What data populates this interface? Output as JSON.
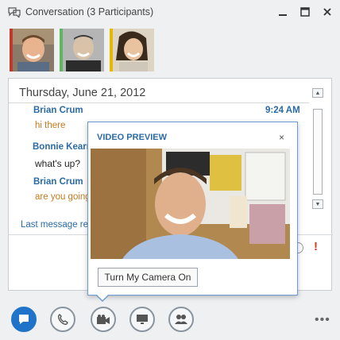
{
  "window": {
    "title": "Conversation (3 Participants)",
    "title_icon": "chat-bubbles-icon",
    "controls": [
      "minimize-icon",
      "maximize-icon",
      "close-icon"
    ]
  },
  "participants": [
    {
      "avatar": "participant-photo-1",
      "stripe_color": "#c0392b"
    },
    {
      "avatar": "participant-photo-2",
      "stripe_color": "#5cb85c"
    },
    {
      "avatar": "participant-photo-3",
      "stripe_color": "#e6b800"
    }
  ],
  "conversation": {
    "date": "Thursday, June 21, 2012",
    "messages": [
      {
        "sender": "Brian Crum",
        "text": "hi there",
        "time": "9:24 AM",
        "text_color": "#c27b1f"
      },
      {
        "sender": "Bonnie Kearney",
        "text": "what's up?",
        "text_color": "#222222"
      },
      {
        "sender": "Brian Crum",
        "text": "are you going",
        "text_color": "#c27b1f"
      }
    ],
    "last_message": "Last message received",
    "urgent_label": "!"
  },
  "video_preview": {
    "title": "VIDEO PREVIEW",
    "close": "×",
    "camera_button": "Turn My Camera On"
  },
  "toolbar": {
    "buttons": [
      "im-icon",
      "phone-icon",
      "video-camera-icon",
      "present-icon",
      "participants-icon"
    ],
    "more": "•••",
    "accent": "#1f73c9"
  }
}
